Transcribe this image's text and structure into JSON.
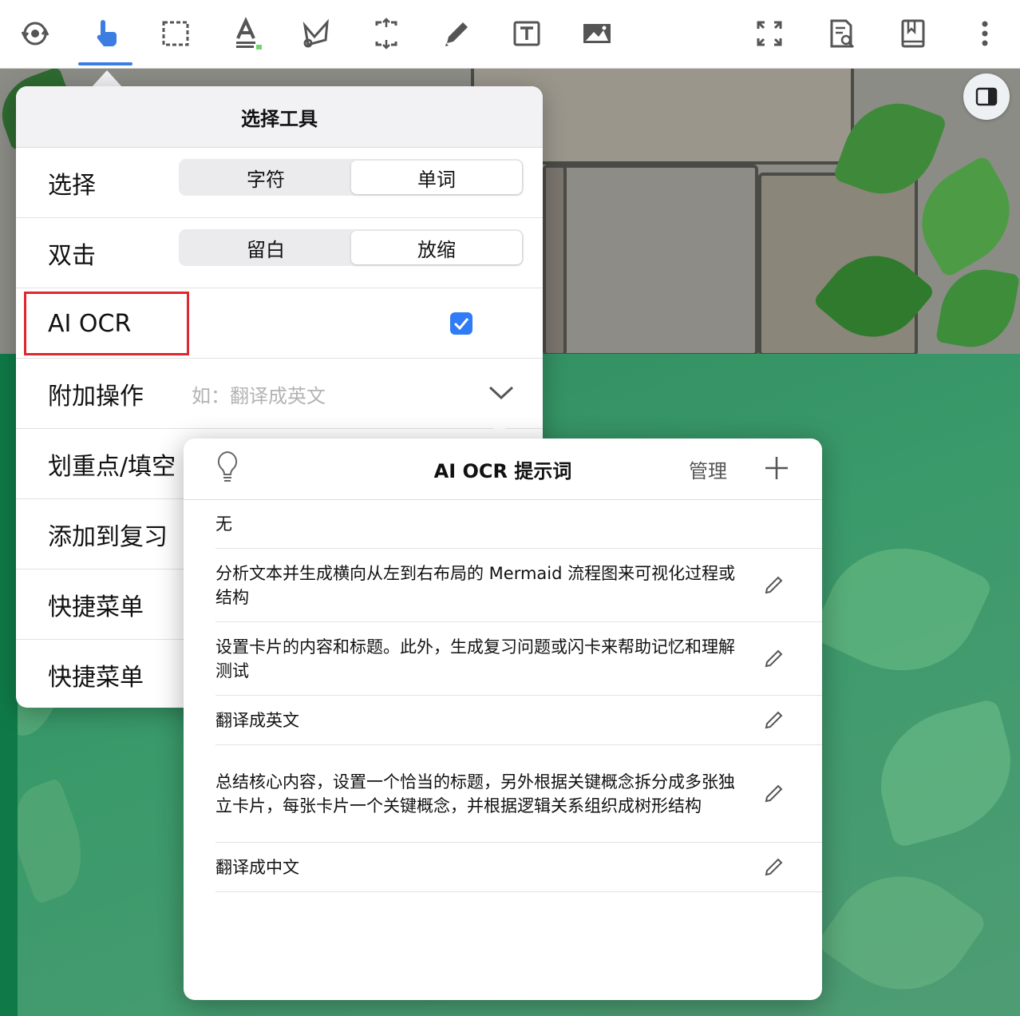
{
  "toolbar": {
    "tools": [
      {
        "icon": "refresh-gear-icon"
      },
      {
        "icon": "hand-pointer-icon",
        "active": true
      },
      {
        "icon": "rectangle-select-icon"
      },
      {
        "icon": "text-highlight-icon"
      },
      {
        "icon": "lasso-pen-icon"
      },
      {
        "icon": "expand-crop-icon"
      },
      {
        "icon": "pencil-icon"
      },
      {
        "icon": "text-box-icon"
      },
      {
        "icon": "image-icon"
      },
      {
        "icon": "fullscreen-icon"
      },
      {
        "icon": "search-document-icon"
      },
      {
        "icon": "bookmark-book-icon"
      },
      {
        "icon": "more-vertical-icon"
      }
    ],
    "accent": "#3b7de0"
  },
  "popover": {
    "title": "选择工具",
    "rows": {
      "select": {
        "label": "选择",
        "options": [
          "字符",
          "单词"
        ],
        "selected": "单词"
      },
      "double_click": {
        "label": "双击",
        "options": [
          "留白",
          "放缩"
        ],
        "selected": "放缩"
      },
      "ai_ocr": {
        "label": "AI OCR",
        "checked": true
      },
      "extra_action": {
        "label": "附加操作",
        "placeholder": "如：翻译成英文"
      },
      "highlight": {
        "label": "划重点/填空"
      },
      "add_review": {
        "label": "添加到复习"
      },
      "quick_menu_1": {
        "label": "快捷菜单"
      },
      "quick_menu_2": {
        "label": "快捷菜单"
      }
    }
  },
  "prompts": {
    "title": "AI OCR 提示词",
    "manage": "管理",
    "items": [
      {
        "text": "无"
      },
      {
        "text": "分析文本并生成横向从左到右布局的 Mermaid 流程图来可视化过程或结构"
      },
      {
        "text": "设置卡片的内容和标题。此外，生成复习问题或闪卡来帮助记忆和理解测试"
      },
      {
        "text": "翻译成英文"
      },
      {
        "text": "总结核心内容，设置一个恰当的标题，另外根据关键概念拆分成多张独立卡片，每张卡片一个关键概念，并根据逻辑关系组织成树形结构"
      },
      {
        "text": "翻译成中文"
      }
    ]
  },
  "colors": {
    "checkbox": "#2f7cf6",
    "highlight_box": "#e0262e",
    "popover_header": "#f2f2f4"
  }
}
